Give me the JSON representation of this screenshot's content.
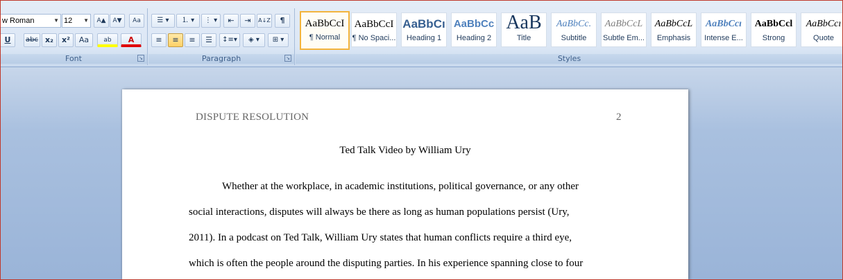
{
  "font_group": {
    "label": "Font",
    "font_name": "w Roman",
    "font_size": "12",
    "grow_icon": "A▲",
    "shrink_icon": "A▼",
    "clear_icon": "Aa",
    "underline": "U",
    "strike": "abc",
    "subscript": "x₂",
    "superscript": "x²",
    "change_case": "Aa",
    "highlight": "ab",
    "font_color": "A"
  },
  "paragraph_group": {
    "label": "Paragraph",
    "sort": "A↓Z",
    "pilcrow": "¶"
  },
  "styles_group": {
    "label": "Styles",
    "items": [
      {
        "preview": "AaBbCcI",
        "name": "¶ Normal"
      },
      {
        "preview": "AaBbCcI",
        "name": "¶ No Spaci..."
      },
      {
        "preview": "AaBbCı",
        "name": "Heading 1"
      },
      {
        "preview": "AaBbCc",
        "name": "Heading 2"
      },
      {
        "preview": "AaB",
        "name": "Title"
      },
      {
        "preview": "AaBbCc.",
        "name": "Subtitle"
      },
      {
        "preview": "AaBbCcL",
        "name": "Subtle Em..."
      },
      {
        "preview": "AaBbCcL",
        "name": "Emphasis"
      },
      {
        "preview": "AaBbCcı",
        "name": "Intense E..."
      },
      {
        "preview": "AaBbCcl",
        "name": "Strong"
      },
      {
        "preview": "AaBbCcı",
        "name": "Quote"
      }
    ]
  },
  "document": {
    "running_head": "DISPUTE RESOLUTION",
    "page_number": "2",
    "title": "Ted Talk Video by William  Ury",
    "lines": [
      "Whether at the workplace, in academic institutions, political governance, or any other",
      "social interactions, disputes will always be there as long as human populations persist (Ury,",
      "2011). In a podcast on Ted Talk, William  Ury states that human conflicts require a third eye,",
      "which is  often the people around the disputing parties. In his experience  spanning close to four"
    ]
  }
}
